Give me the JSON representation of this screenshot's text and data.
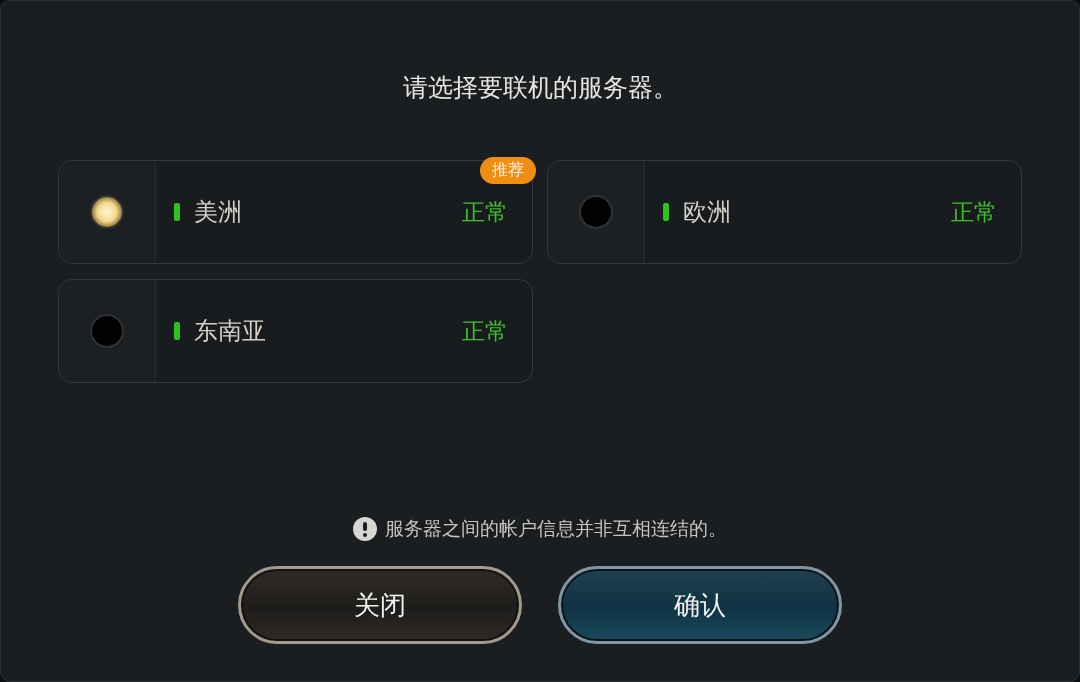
{
  "title": "请选择要联机的服务器。",
  "servers": [
    {
      "name": "美洲",
      "status": "正常",
      "badge": "推荐",
      "selected": true
    },
    {
      "name": "欧洲",
      "status": "正常",
      "selected": false
    },
    {
      "name": "东南亚",
      "status": "正常",
      "selected": false
    }
  ],
  "notice": "服务器之间的帐户信息并非互相连结的。",
  "buttons": [
    {
      "label": "关闭",
      "kind": "secondary"
    },
    {
      "label": "确认",
      "kind": "primary"
    }
  ]
}
